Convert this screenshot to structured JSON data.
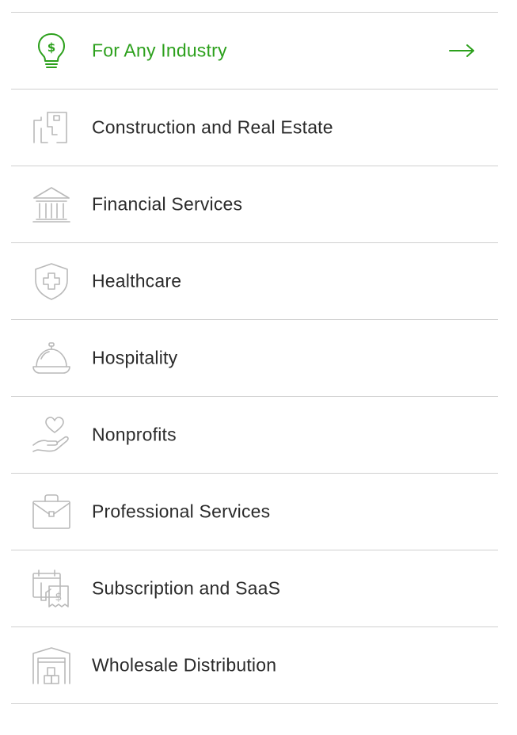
{
  "colors": {
    "accent": "#2ca01c",
    "text": "#2b2b2b",
    "icon_muted": "#b9b9b9",
    "divider": "#cfcfcf"
  },
  "industries": [
    {
      "label": "For Any Industry",
      "icon": "lightbulb-dollar-icon",
      "active": true
    },
    {
      "label": "Construction and Real Estate",
      "icon": "floor-plan-icon",
      "active": false
    },
    {
      "label": "Financial Services",
      "icon": "bank-icon",
      "active": false
    },
    {
      "label": "Healthcare",
      "icon": "medical-shield-icon",
      "active": false
    },
    {
      "label": "Hospitality",
      "icon": "service-bell-icon",
      "active": false
    },
    {
      "label": "Nonprofits",
      "icon": "heart-hand-icon",
      "active": false
    },
    {
      "label": "Professional Services",
      "icon": "briefcase-icon",
      "active": false
    },
    {
      "label": "Subscription and SaaS",
      "icon": "calendar-receipt-icon",
      "active": false
    },
    {
      "label": "Wholesale Distribution",
      "icon": "warehouse-icon",
      "active": false
    }
  ],
  "active_item_arrow_icon": "arrow-right-icon"
}
